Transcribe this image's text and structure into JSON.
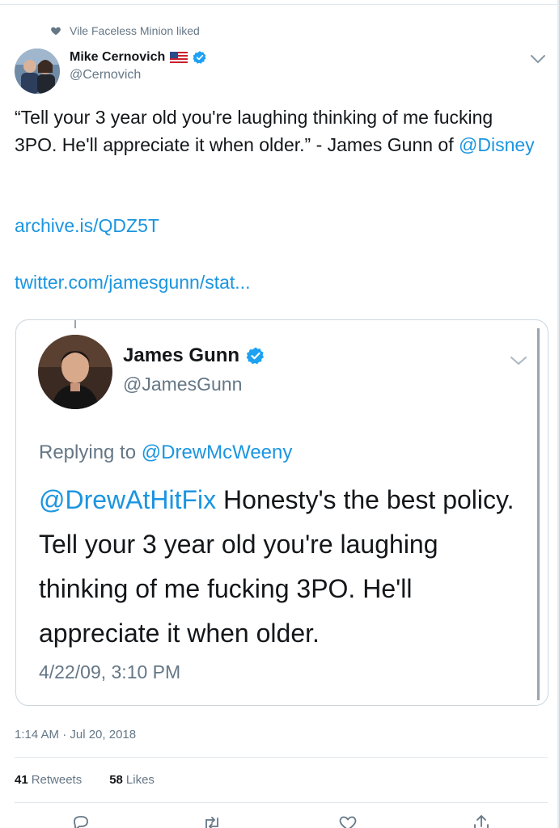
{
  "social_context": {
    "text": "Vile Faceless Minion liked"
  },
  "author": {
    "name": "Mike Cernovich",
    "handle": "@Cernovich"
  },
  "tweet": {
    "text_before": "“Tell your 3 year old you're laughing thinking of me fucking 3PO. He'll appreciate it when older.” - James Gunn of ",
    "mention": "@Disney",
    "link1": "archive.is/QDZ5T",
    "link2": "twitter.com/jamesgunn/stat..."
  },
  "quoted": {
    "name": "James Gunn",
    "handle": "@JamesGunn",
    "reply_prefix": "Replying to ",
    "reply_to": "@DrewMcWeeny",
    "mention": "@DrewAtHitFix",
    "body": " Honesty's the best policy. Tell your 3 year old you're laughing thinking of me fucking 3PO. He'll appreciate it when older.",
    "date": "4/22/09, 3:10 PM"
  },
  "meta": {
    "timestamp": "1:14 AM · Jul 20, 2018",
    "retweets_count": "41",
    "retweets_label": "Retweets",
    "likes_count": "58",
    "likes_label": "Likes"
  },
  "icons": [
    "heart-icon",
    "flag-icon",
    "verified-icon",
    "chevron-down-icon",
    "reply-icon",
    "retweet-icon",
    "like-icon",
    "share-icon"
  ],
  "colors": {
    "link": "#1b95e0",
    "secondary": "#657786",
    "verified": "#1da1f2",
    "border": "#ccd6dd"
  }
}
